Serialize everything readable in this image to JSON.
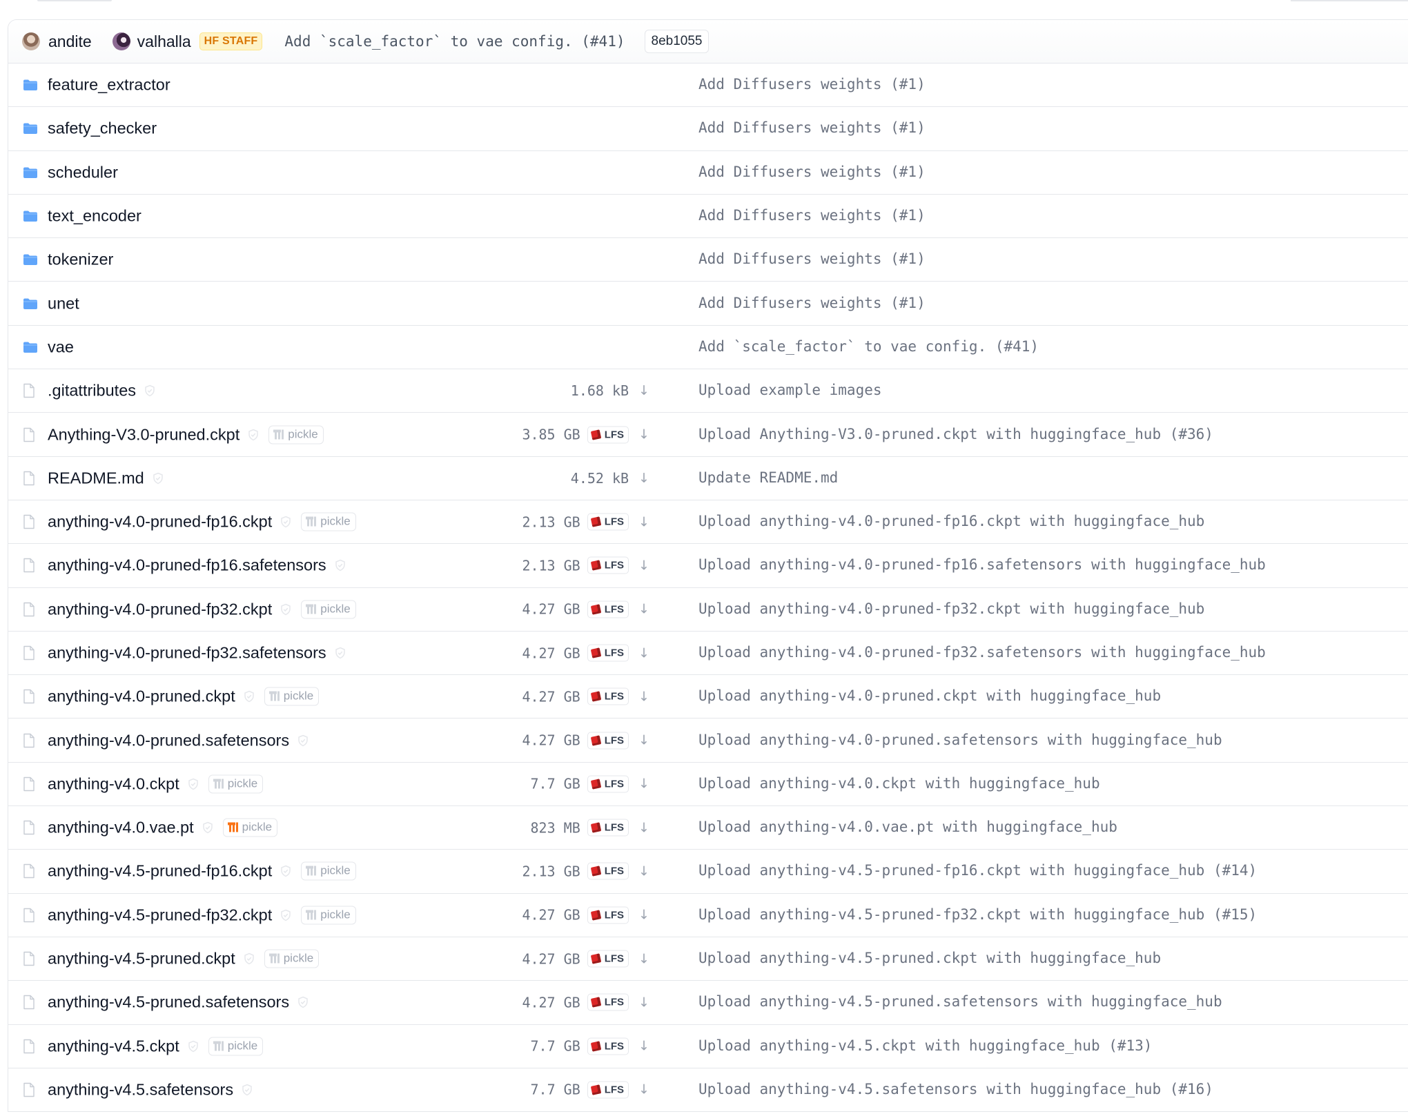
{
  "latest_commit": {
    "authors": [
      {
        "name": "andite",
        "avatar": "avatar"
      },
      {
        "name": "valhalla",
        "avatar": "avatar",
        "badge": "HF STAFF"
      }
    ],
    "message": "Add `scale_factor` to vae config. (#41)",
    "hash": "8eb1055"
  },
  "folders": [
    {
      "name": "feature_extractor",
      "commit": "Add Diffusers weights (#1)"
    },
    {
      "name": "safety_checker",
      "commit": "Add Diffusers weights (#1)"
    },
    {
      "name": "scheduler",
      "commit": "Add Diffusers weights (#1)"
    },
    {
      "name": "text_encoder",
      "commit": "Add Diffusers weights (#1)"
    },
    {
      "name": "tokenizer",
      "commit": "Add Diffusers weights (#1)"
    },
    {
      "name": "unet",
      "commit": "Add Diffusers weights (#1)"
    },
    {
      "name": "vae",
      "commit": "Add `scale_factor` to vae config. (#41)"
    }
  ],
  "files": [
    {
      "name": ".gitattributes",
      "size": "1.68 kB",
      "lfs": false,
      "pickle": false,
      "commit": "Upload example images"
    },
    {
      "name": "Anything-V3.0-pruned.ckpt",
      "size": "3.85 GB",
      "lfs": true,
      "pickle": true,
      "pickle_warn": false,
      "commit": "Upload Anything-V3.0-pruned.ckpt with huggingface_hub (#36)"
    },
    {
      "name": "README.md",
      "size": "4.52 kB",
      "lfs": false,
      "pickle": false,
      "commit": "Update README.md"
    },
    {
      "name": "anything-v4.0-pruned-fp16.ckpt",
      "size": "2.13 GB",
      "lfs": true,
      "pickle": true,
      "pickle_warn": false,
      "commit": "Upload anything-v4.0-pruned-fp16.ckpt with huggingface_hub"
    },
    {
      "name": "anything-v4.0-pruned-fp16.safetensors",
      "size": "2.13 GB",
      "lfs": true,
      "pickle": false,
      "commit": "Upload anything-v4.0-pruned-fp16.safetensors with huggingface_hub"
    },
    {
      "name": "anything-v4.0-pruned-fp32.ckpt",
      "size": "4.27 GB",
      "lfs": true,
      "pickle": true,
      "pickle_warn": false,
      "commit": "Upload anything-v4.0-pruned-fp32.ckpt with huggingface_hub"
    },
    {
      "name": "anything-v4.0-pruned-fp32.safetensors",
      "size": "4.27 GB",
      "lfs": true,
      "pickle": false,
      "commit": "Upload anything-v4.0-pruned-fp32.safetensors with huggingface_hub"
    },
    {
      "name": "anything-v4.0-pruned.ckpt",
      "size": "4.27 GB",
      "lfs": true,
      "pickle": true,
      "pickle_warn": false,
      "commit": "Upload anything-v4.0-pruned.ckpt with huggingface_hub"
    },
    {
      "name": "anything-v4.0-pruned.safetensors",
      "size": "4.27 GB",
      "lfs": true,
      "pickle": false,
      "commit": "Upload anything-v4.0-pruned.safetensors with huggingface_hub"
    },
    {
      "name": "anything-v4.0.ckpt",
      "size": "7.7 GB",
      "lfs": true,
      "pickle": true,
      "pickle_warn": false,
      "commit": "Upload anything-v4.0.ckpt with huggingface_hub"
    },
    {
      "name": "anything-v4.0.vae.pt",
      "size": "823 MB",
      "lfs": true,
      "pickle": true,
      "pickle_warn": true,
      "commit": "Upload anything-v4.0.vae.pt with huggingface_hub"
    },
    {
      "name": "anything-v4.5-pruned-fp16.ckpt",
      "size": "2.13 GB",
      "lfs": true,
      "pickle": true,
      "pickle_warn": false,
      "commit": "Upload anything-v4.5-pruned-fp16.ckpt with huggingface_hub (#14)"
    },
    {
      "name": "anything-v4.5-pruned-fp32.ckpt",
      "size": "4.27 GB",
      "lfs": true,
      "pickle": true,
      "pickle_warn": false,
      "commit": "Upload anything-v4.5-pruned-fp32.ckpt with huggingface_hub (#15)"
    },
    {
      "name": "anything-v4.5-pruned.ckpt",
      "size": "4.27 GB",
      "lfs": true,
      "pickle": true,
      "pickle_warn": false,
      "commit": "Upload anything-v4.5-pruned.ckpt with huggingface_hub"
    },
    {
      "name": "anything-v4.5-pruned.safetensors",
      "size": "4.27 GB",
      "lfs": true,
      "pickle": false,
      "commit": "Upload anything-v4.5-pruned.safetensors with huggingface_hub"
    },
    {
      "name": "anything-v4.5.ckpt",
      "size": "7.7 GB",
      "lfs": true,
      "pickle": true,
      "pickle_warn": false,
      "commit": "Upload anything-v4.5.ckpt with huggingface_hub (#13)"
    },
    {
      "name": "anything-v4.5.safetensors",
      "size": "7.7 GB",
      "lfs": true,
      "pickle": false,
      "commit": "Upload anything-v4.5.safetensors with huggingface_hub (#16)"
    }
  ],
  "labels": {
    "pickle": "pickle",
    "lfs": "LFS",
    "download_glyph": "↓"
  },
  "colors": {
    "folder": "#60a5fa",
    "pickle_warn": "#f97316",
    "lfs": "#dc2626",
    "staff": "#d97706"
  }
}
